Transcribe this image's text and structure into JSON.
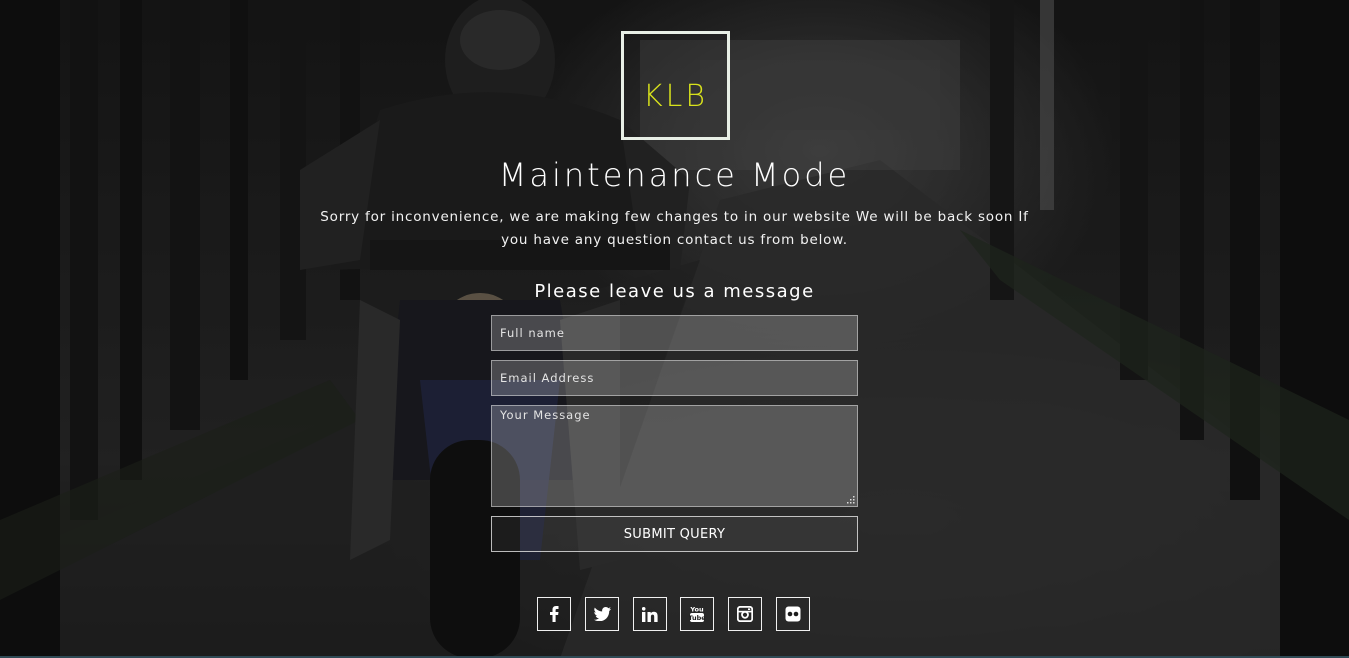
{
  "logo": {
    "text": "KLB",
    "accent_color": "#d8e21c"
  },
  "page_title": "Maintenance Mode",
  "message": "Sorry for inconvenience, we are making few changes to in our website We will be back soon If you have any question contact us from below.",
  "form": {
    "heading": "Please leave us a message",
    "name_placeholder": "Full name",
    "email_placeholder": "Email Address",
    "message_placeholder": "Your Message",
    "submit_label": "SUBMIT QUERY"
  },
  "social": [
    {
      "icon": "facebook-icon"
    },
    {
      "icon": "twitter-icon"
    },
    {
      "icon": "linkedin-icon"
    },
    {
      "icon": "youtube-icon"
    },
    {
      "icon": "instagram-icon"
    },
    {
      "icon": "flickr-icon"
    }
  ],
  "colors": {
    "text": "#ffffff",
    "border": "#e8efe6",
    "accent": "#d8e21c"
  }
}
